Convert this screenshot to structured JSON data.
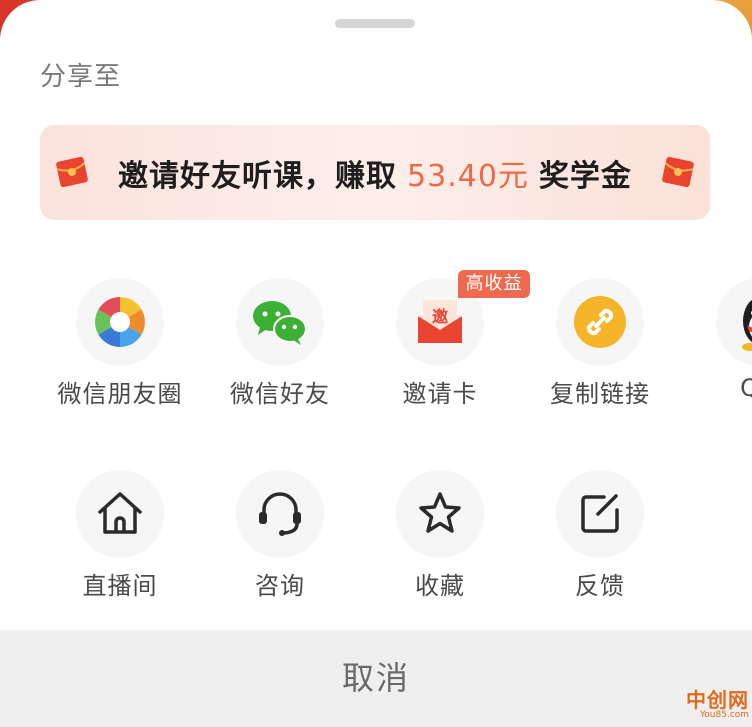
{
  "share": {
    "title": "分享至"
  },
  "banner": {
    "text_before": "邀请好友听课，赚取",
    "amount": "53.40元",
    "text_after": "奖学金"
  },
  "row1": [
    {
      "label": "微信朋友圈",
      "icon": "camera-aperture-icon"
    },
    {
      "label": "微信好友",
      "icon": "wechat-icon"
    },
    {
      "label": "邀请卡",
      "icon": "invite-card-icon"
    },
    {
      "label": "复制链接",
      "icon": "link-icon"
    },
    {
      "label": "QQ",
      "icon": "qq-icon"
    }
  ],
  "badge": {
    "label": "高收益"
  },
  "invite_card_glyph": "邀",
  "row2": [
    {
      "label": "直播间",
      "icon": "home-icon"
    },
    {
      "label": "咨询",
      "icon": "headset-icon"
    },
    {
      "label": "收藏",
      "icon": "star-icon"
    },
    {
      "label": "反馈",
      "icon": "edit-icon"
    }
  ],
  "cancel": {
    "label": "取消"
  },
  "watermark": {
    "text": "中创网",
    "sub": "You85.com"
  },
  "colors": {
    "accent": "#ee6a44",
    "badge": "#ee6a4f",
    "wechat_green": "#3cb035",
    "link_yellow": "#f6b428"
  }
}
